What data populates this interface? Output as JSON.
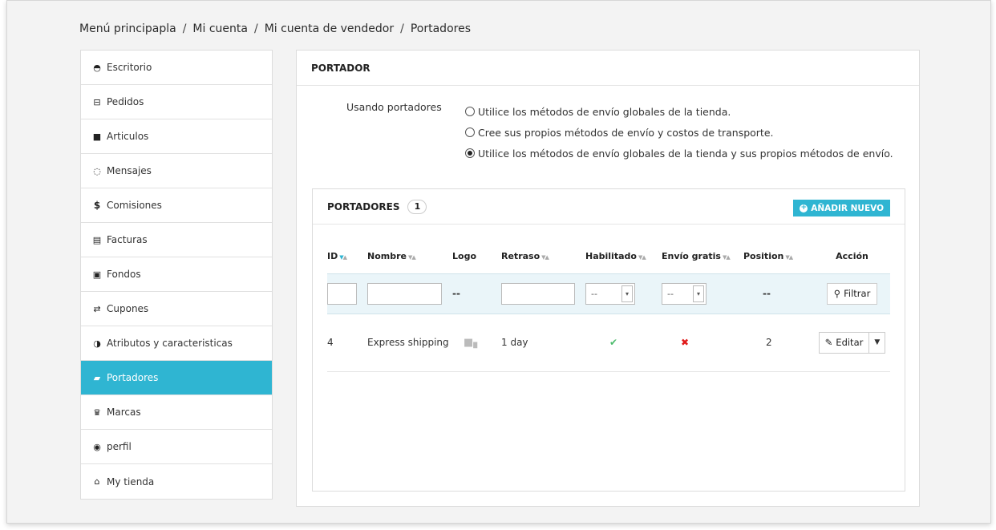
{
  "breadcrumb": [
    "Menú principapla",
    "Mi cuenta",
    "Mi cuenta de vendedor",
    "Portadores"
  ],
  "sidebar": {
    "items": [
      {
        "label": "Escritorio",
        "icon": "dashboard-icon",
        "active": false
      },
      {
        "label": "Pedidos",
        "icon": "basket-icon",
        "active": false
      },
      {
        "label": "Articulos",
        "icon": "gift-icon",
        "active": false
      },
      {
        "label": "Mensajes",
        "icon": "message-icon",
        "active": false
      },
      {
        "label": "Comisiones",
        "icon": "dollar-icon",
        "active": false
      },
      {
        "label": "Facturas",
        "icon": "invoice-icon",
        "active": false
      },
      {
        "label": "Fondos",
        "icon": "money-icon",
        "active": false
      },
      {
        "label": "Cupones",
        "icon": "exchange-icon",
        "active": false
      },
      {
        "label": "Atributos y caracteristicas",
        "icon": "contrast-icon",
        "active": false
      },
      {
        "label": "Portadores",
        "icon": "truck-icon",
        "active": true
      },
      {
        "label": "Marcas",
        "icon": "trophy-icon",
        "active": false
      },
      {
        "label": "perfil",
        "icon": "user-circle-icon",
        "active": false
      },
      {
        "label": "My tienda",
        "icon": "home-icon",
        "active": false
      }
    ]
  },
  "panel": {
    "title": "PORTADOR",
    "using_label": "Usando portadores",
    "options": [
      {
        "label": "Utilice los métodos de envío globales de la tienda.",
        "checked": false
      },
      {
        "label": "Cree sus propios métodos de envío y costos de transporte.",
        "checked": false
      },
      {
        "label": "Utilice los métodos de envío globales de la tienda y sus propios métodos de envío.",
        "checked": true
      }
    ]
  },
  "carriers": {
    "title": "PORTADORES",
    "count": "1",
    "add_label": "AÑADIR NUEVO",
    "columns": {
      "id": "ID",
      "name": "Nombre",
      "logo": "Logo",
      "delay": "Retraso",
      "enabled": "Habilitado",
      "free": "Envío gratis",
      "position": "Position",
      "action": "Acción"
    },
    "filter": {
      "logo_dash": "--",
      "enabled_value": "--",
      "free_value": "--",
      "position_dash": "--",
      "filter_label": "Filtrar"
    },
    "rows": [
      {
        "id": "4",
        "name": "Express shipping",
        "delay": "1 day",
        "enabled": true,
        "free": false,
        "position": "2",
        "edit_label": "Editar"
      }
    ]
  },
  "colors": {
    "accent": "#2fb5d2",
    "check": "#4cbb6c",
    "cross": "#e01a1a"
  }
}
